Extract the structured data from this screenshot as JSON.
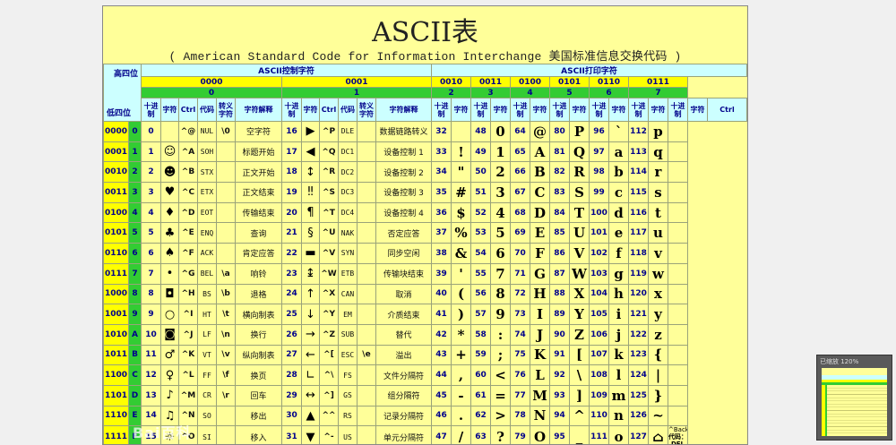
{
  "title": "ASCII表",
  "subtitle": "( American Standard Code for Information Interchange 美国标准信息交换代码 )",
  "corner_top": "高四位",
  "corner_bottom": "低四位",
  "group_control": "ASCII控制字符",
  "group_printable": "ASCII打印字符",
  "column_groups": [
    {
      "bits": "0000",
      "num": "0"
    },
    {
      "bits": "0001",
      "num": "1"
    },
    {
      "bits": "0010",
      "num": "2"
    },
    {
      "bits": "0011",
      "num": "3"
    },
    {
      "bits": "0100",
      "num": "4"
    },
    {
      "bits": "0101",
      "num": "5"
    },
    {
      "bits": "0110",
      "num": "6"
    },
    {
      "bits": "0111",
      "num": "7"
    }
  ],
  "ctrl_headers": {
    "dec": "十进制",
    "char": "字符",
    "ctrl": "Ctrl",
    "code": "代码",
    "esc": "转义字符",
    "desc": "字符解释"
  },
  "print_headers": {
    "dec": "十进制",
    "char": "字符",
    "ctrl": "Ctrl"
  },
  "rows": [
    {
      "bits": "0000",
      "h": "0",
      "c0": [
        "0",
        "",
        "^@",
        "NUL",
        "\\0",
        "空字符"
      ],
      "c1": [
        "16",
        "▶",
        "^P",
        "DLE",
        "",
        "数据链路转义"
      ],
      "p": [
        [
          "32",
          ""
        ],
        [
          "48",
          "0"
        ],
        [
          "64",
          "@"
        ],
        [
          "80",
          "P"
        ],
        [
          "96",
          "`"
        ],
        [
          "112",
          "p"
        ]
      ]
    },
    {
      "bits": "0001",
      "h": "1",
      "c0": [
        "1",
        "☺",
        "^A",
        "SOH",
        "",
        "标题开始"
      ],
      "c1": [
        "17",
        "◀",
        "^Q",
        "DC1",
        "",
        "设备控制 1"
      ],
      "p": [
        [
          "33",
          "!"
        ],
        [
          "49",
          "1"
        ],
        [
          "65",
          "A"
        ],
        [
          "81",
          "Q"
        ],
        [
          "97",
          "a"
        ],
        [
          "113",
          "q"
        ]
      ]
    },
    {
      "bits": "0010",
      "h": "2",
      "c0": [
        "2",
        "☻",
        "^B",
        "STX",
        "",
        "正文开始"
      ],
      "c1": [
        "18",
        "↕",
        "^R",
        "DC2",
        "",
        "设备控制 2"
      ],
      "p": [
        [
          "34",
          "\""
        ],
        [
          "50",
          "2"
        ],
        [
          "66",
          "B"
        ],
        [
          "82",
          "R"
        ],
        [
          "98",
          "b"
        ],
        [
          "114",
          "r"
        ]
      ]
    },
    {
      "bits": "0011",
      "h": "3",
      "c0": [
        "3",
        "♥",
        "^C",
        "ETX",
        "",
        "正文结束"
      ],
      "c1": [
        "19",
        "‼",
        "^S",
        "DC3",
        "",
        "设备控制 3"
      ],
      "p": [
        [
          "35",
          "#"
        ],
        [
          "51",
          "3"
        ],
        [
          "67",
          "C"
        ],
        [
          "83",
          "S"
        ],
        [
          "99",
          "c"
        ],
        [
          "115",
          "s"
        ]
      ]
    },
    {
      "bits": "0100",
      "h": "4",
      "c0": [
        "4",
        "♦",
        "^D",
        "EOT",
        "",
        "传输结束"
      ],
      "c1": [
        "20",
        "¶",
        "^T",
        "DC4",
        "",
        "设备控制 4"
      ],
      "p": [
        [
          "36",
          "$"
        ],
        [
          "52",
          "4"
        ],
        [
          "68",
          "D"
        ],
        [
          "84",
          "T"
        ],
        [
          "100",
          "d"
        ],
        [
          "116",
          "t"
        ]
      ]
    },
    {
      "bits": "0101",
      "h": "5",
      "c0": [
        "5",
        "♣",
        "^E",
        "ENQ",
        "",
        "查询"
      ],
      "c1": [
        "21",
        "§",
        "^U",
        "NAK",
        "",
        "否定应答"
      ],
      "p": [
        [
          "37",
          "%"
        ],
        [
          "53",
          "5"
        ],
        [
          "69",
          "E"
        ],
        [
          "85",
          "U"
        ],
        [
          "101",
          "e"
        ],
        [
          "117",
          "u"
        ]
      ]
    },
    {
      "bits": "0110",
      "h": "6",
      "c0": [
        "6",
        "♠",
        "^F",
        "ACK",
        "",
        "肯定应答"
      ],
      "c1": [
        "22",
        "▬",
        "^V",
        "SYN",
        "",
        "同步空闲"
      ],
      "p": [
        [
          "38",
          "&"
        ],
        [
          "54",
          "6"
        ],
        [
          "70",
          "F"
        ],
        [
          "86",
          "V"
        ],
        [
          "102",
          "f"
        ],
        [
          "118",
          "v"
        ]
      ]
    },
    {
      "bits": "0111",
      "h": "7",
      "c0": [
        "7",
        "•",
        "^G",
        "BEL",
        "\\a",
        "响铃"
      ],
      "c1": [
        "23",
        "↨",
        "^W",
        "ETB",
        "",
        "传输块结束"
      ],
      "p": [
        [
          "39",
          "'"
        ],
        [
          "55",
          "7"
        ],
        [
          "71",
          "G"
        ],
        [
          "87",
          "W"
        ],
        [
          "103",
          "g"
        ],
        [
          "119",
          "w"
        ]
      ]
    },
    {
      "bits": "1000",
      "h": "8",
      "c0": [
        "8",
        "◘",
        "^H",
        "BS",
        "\\b",
        "退格"
      ],
      "c1": [
        "24",
        "↑",
        "^X",
        "CAN",
        "",
        "取消"
      ],
      "p": [
        [
          "40",
          "("
        ],
        [
          "56",
          "8"
        ],
        [
          "72",
          "H"
        ],
        [
          "88",
          "X"
        ],
        [
          "104",
          "h"
        ],
        [
          "120",
          "x"
        ]
      ]
    },
    {
      "bits": "1001",
      "h": "9",
      "c0": [
        "9",
        "○",
        "^I",
        "HT",
        "\\t",
        "横向制表"
      ],
      "c1": [
        "25",
        "↓",
        "^Y",
        "EM",
        "",
        "介质结束"
      ],
      "p": [
        [
          "41",
          ")"
        ],
        [
          "57",
          "9"
        ],
        [
          "73",
          "I"
        ],
        [
          "89",
          "Y"
        ],
        [
          "105",
          "i"
        ],
        [
          "121",
          "y"
        ]
      ]
    },
    {
      "bits": "1010",
      "h": "A",
      "c0": [
        "10",
        "◙",
        "^J",
        "LF",
        "\\n",
        "换行"
      ],
      "c1": [
        "26",
        "→",
        "^Z",
        "SUB",
        "",
        "替代"
      ],
      "p": [
        [
          "42",
          "*"
        ],
        [
          "58",
          ":"
        ],
        [
          "74",
          "J"
        ],
        [
          "90",
          "Z"
        ],
        [
          "106",
          "j"
        ],
        [
          "122",
          "z"
        ]
      ]
    },
    {
      "bits": "1011",
      "h": "B",
      "c0": [
        "11",
        "♂",
        "^K",
        "VT",
        "\\v",
        "纵向制表"
      ],
      "c1": [
        "27",
        "←",
        "^[",
        "ESC",
        "\\e",
        "溢出"
      ],
      "p": [
        [
          "43",
          "+"
        ],
        [
          "59",
          ";"
        ],
        [
          "75",
          "K"
        ],
        [
          "91",
          "["
        ],
        [
          "107",
          "k"
        ],
        [
          "123",
          "{"
        ]
      ]
    },
    {
      "bits": "1100",
      "h": "C",
      "c0": [
        "12",
        "♀",
        "^L",
        "FF",
        "\\f",
        "换页"
      ],
      "c1": [
        "28",
        "∟",
        "^\\",
        "FS",
        "",
        "文件分隔符"
      ],
      "p": [
        [
          "44",
          ","
        ],
        [
          "60",
          "<"
        ],
        [
          "76",
          "L"
        ],
        [
          "92",
          "\\"
        ],
        [
          "108",
          "l"
        ],
        [
          "124",
          "|"
        ]
      ]
    },
    {
      "bits": "1101",
      "h": "D",
      "c0": [
        "13",
        "♪",
        "^M",
        "CR",
        "\\r",
        "回车"
      ],
      "c1": [
        "29",
        "↔",
        "^]",
        "GS",
        "",
        "组分隔符"
      ],
      "p": [
        [
          "45",
          "-"
        ],
        [
          "61",
          "="
        ],
        [
          "77",
          "M"
        ],
        [
          "93",
          "]"
        ],
        [
          "109",
          "m"
        ],
        [
          "125",
          "}"
        ]
      ]
    },
    {
      "bits": "1110",
      "h": "E",
      "c0": [
        "14",
        "♫",
        "^N",
        "SO",
        "",
        "移出"
      ],
      "c1": [
        "30",
        "▲",
        "^^",
        "RS",
        "",
        "记录分隔符"
      ],
      "p": [
        [
          "46",
          "."
        ],
        [
          "62",
          ">"
        ],
        [
          "78",
          "N"
        ],
        [
          "94",
          "^"
        ],
        [
          "110",
          "n"
        ],
        [
          "126",
          "~"
        ]
      ]
    },
    {
      "bits": "1111",
      "h": "F",
      "c0": [
        "15",
        "☼",
        "^O",
        "SI",
        "",
        "移入"
      ],
      "c1": [
        "31",
        "▼",
        "^-",
        "US",
        "",
        "单元分隔符"
      ],
      "p": [
        [
          "47",
          "/"
        ],
        [
          "63",
          "?"
        ],
        [
          "79",
          "O"
        ],
        [
          "95",
          "_"
        ],
        [
          "111",
          "o"
        ],
        [
          "127",
          "⌂"
        ]
      ]
    }
  ],
  "last_ctrl": {
    "backspace": "^Backspace",
    "code": "代码：DEL"
  },
  "thumbnail": {
    "caption": "已缩放 120%"
  },
  "watermark": "Bai百科",
  "colors": {
    "sheet": "#ffff99",
    "header_cyan": "#ccffff",
    "header_yellow": "#ffff00",
    "header_green": "#33cc33",
    "text_navy": "#00008b"
  }
}
